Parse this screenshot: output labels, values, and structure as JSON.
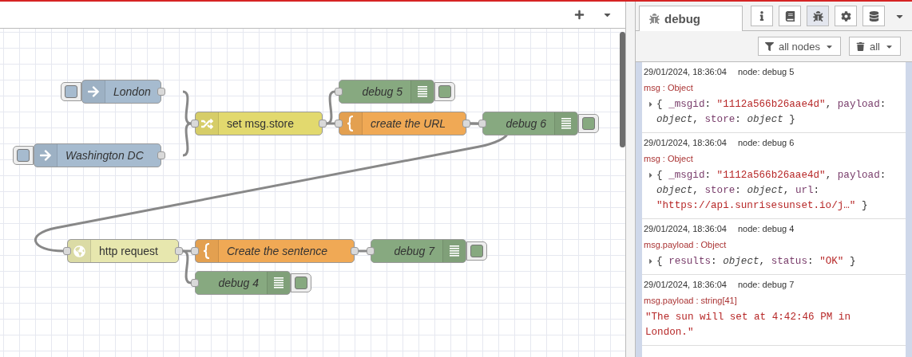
{
  "canvas": {
    "nodes": [
      {
        "kind": "inject",
        "label": "London"
      },
      {
        "kind": "inject",
        "label": "Washington DC"
      },
      {
        "kind": "change",
        "label": "set msg.store"
      },
      {
        "kind": "debug",
        "label": "debug 5"
      },
      {
        "kind": "template",
        "label": "create the URL"
      },
      {
        "kind": "debug",
        "label": "debug 6"
      },
      {
        "kind": "http",
        "label": "http request"
      },
      {
        "kind": "template",
        "label": "Create the sentence"
      },
      {
        "kind": "debug",
        "label": "debug 7"
      },
      {
        "kind": "debug",
        "label": "debug 4"
      }
    ]
  },
  "sidebar": {
    "tab": {
      "label": "debug",
      "selected": true
    },
    "tool_buttons": [
      {
        "kind": "info",
        "selected": false
      },
      {
        "kind": "help",
        "selected": false
      },
      {
        "kind": "debug",
        "selected": true
      },
      {
        "kind": "config",
        "selected": false
      },
      {
        "kind": "context",
        "selected": false
      }
    ],
    "filter": {
      "label": "all nodes"
    },
    "clear": {
      "label": "all"
    },
    "messages": [
      {
        "time": "29/01/2024, 18:36:04",
        "node": "node: debug 5",
        "topic": "msg : Object",
        "expandable": true,
        "tokens": [
          {
            "kind": "punct",
            "text": "{ "
          },
          {
            "kind": "key",
            "text": "_msgid"
          },
          {
            "kind": "punct",
            "text": ": "
          },
          {
            "kind": "string",
            "text": "\"1112a566b26aae4d\""
          },
          {
            "kind": "punct",
            "text": ", "
          },
          {
            "kind": "key",
            "text": "payload"
          },
          {
            "kind": "punct",
            "text": ": "
          },
          {
            "kind": "type",
            "text": "object"
          },
          {
            "kind": "punct",
            "text": ", "
          },
          {
            "kind": "key",
            "text": "store"
          },
          {
            "kind": "punct",
            "text": ": "
          },
          {
            "kind": "type",
            "text": "object"
          },
          {
            "kind": "punct",
            "text": " }"
          }
        ]
      },
      {
        "time": "29/01/2024, 18:36:04",
        "node": "node: debug 6",
        "topic": "msg : Object",
        "expandable": true,
        "tokens": [
          {
            "kind": "punct",
            "text": "{ "
          },
          {
            "kind": "key",
            "text": "_msgid"
          },
          {
            "kind": "punct",
            "text": ": "
          },
          {
            "kind": "string",
            "text": "\"1112a566b26aae4d\""
          },
          {
            "kind": "punct",
            "text": ", "
          },
          {
            "kind": "key",
            "text": "payload"
          },
          {
            "kind": "punct",
            "text": ": "
          },
          {
            "kind": "type",
            "text": "object"
          },
          {
            "kind": "punct",
            "text": ", "
          },
          {
            "kind": "key",
            "text": "store"
          },
          {
            "kind": "punct",
            "text": ": "
          },
          {
            "kind": "type",
            "text": "object"
          },
          {
            "kind": "punct",
            "text": ", "
          },
          {
            "kind": "key",
            "text": "url"
          },
          {
            "kind": "punct",
            "text": ": "
          },
          {
            "kind": "string",
            "text": "\"https://api.sunrisesunset.io/j…\""
          },
          {
            "kind": "punct",
            "text": " }"
          }
        ]
      },
      {
        "time": "29/01/2024, 18:36:04",
        "node": "node: debug 4",
        "topic": "msg.payload : Object",
        "expandable": true,
        "tokens": [
          {
            "kind": "punct",
            "text": "{ "
          },
          {
            "kind": "key",
            "text": "results"
          },
          {
            "kind": "punct",
            "text": ": "
          },
          {
            "kind": "type",
            "text": "object"
          },
          {
            "kind": "punct",
            "text": ", "
          },
          {
            "kind": "key",
            "text": "status"
          },
          {
            "kind": "punct",
            "text": ": "
          },
          {
            "kind": "string",
            "text": "\"OK\""
          },
          {
            "kind": "punct",
            "text": " }"
          }
        ]
      },
      {
        "time": "29/01/2024, 18:36:04",
        "node": "node: debug 7",
        "topic": "msg.payload : string[41]",
        "expandable": false,
        "tokens": [
          {
            "kind": "string",
            "text": "\"The sun will set at 4:42:46 PM in London.\""
          }
        ]
      }
    ]
  }
}
